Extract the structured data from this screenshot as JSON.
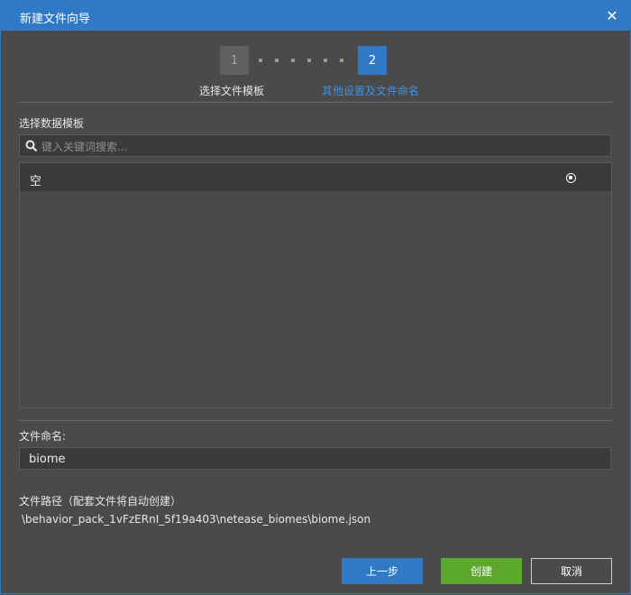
{
  "window": {
    "title": "新建文件向导",
    "close_icon": "close-icon"
  },
  "stepper": {
    "steps": [
      {
        "number": "1",
        "label": "选择文件模板",
        "state": "done"
      },
      {
        "number": "2",
        "label": "其他设置及文件命名",
        "state": "active"
      }
    ],
    "dot_count": 6
  },
  "template_section": {
    "label": "选择数据模板",
    "search": {
      "placeholder": "键入关键词搜索...",
      "value": ""
    },
    "items": [
      {
        "label": "空",
        "selected": true
      }
    ]
  },
  "name_section": {
    "label": "文件命名:",
    "value": "biome"
  },
  "path_section": {
    "label": "文件路径（配套文件将自动创建）",
    "value": "\\behavior_pack_1vFzERnI_5f19a403\\netease_biomes\\biome.json"
  },
  "buttons": {
    "prev": "上一步",
    "create": "创建",
    "cancel": "取消"
  },
  "colors": {
    "accent": "#2f79c7",
    "confirm": "#5ba82b",
    "background": "#4a4a4a"
  }
}
